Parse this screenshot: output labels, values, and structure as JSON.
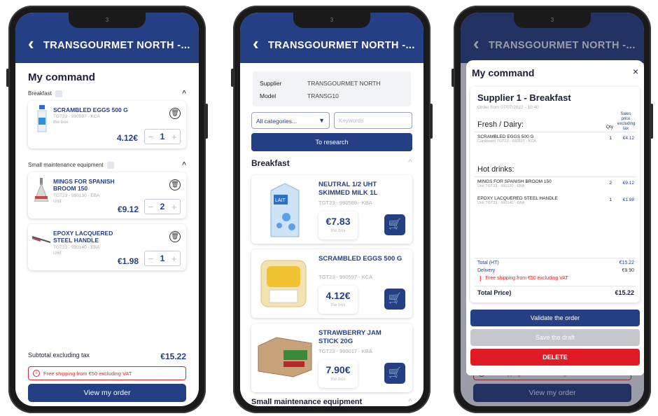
{
  "phone1": {
    "time": "3",
    "header_title": "TRANSGOURMET NORTH -...",
    "heading": "My command",
    "section1": "Breakfast",
    "section2": "Small maintenance equipment",
    "items": [
      {
        "name": "SCRAMBLED EGGS 500 G",
        "ref": "TGT23 - 990597 - KCA",
        "unit": "the box",
        "price": "4.12€",
        "qty": "1"
      },
      {
        "name": "MINGS FOR SPANISH BROOM 150",
        "ref": "TGT23 - 990130 - EBA",
        "unit": "Unit",
        "price": "€9.12",
        "qty": "2"
      },
      {
        "name": "EPOXY LACQUERED STEEL HANDLE",
        "ref": "TGT23 - 990140 - EBA",
        "unit": "Unit",
        "price": "€1.98",
        "qty": "1"
      }
    ],
    "subtotal_label": "Subtotal excluding tax",
    "subtotal_value": "€15.22",
    "warning": "Free shipping from €50 excluding VAT",
    "view_button": "View my order"
  },
  "phone2": {
    "time": "3",
    "header_title": "TRANSGOURMET NORTH -...",
    "supplier_label": "Supplier",
    "supplier_value": "TRANSGOURMET NORTH",
    "model_label": "Model",
    "model_value": "TRANSG10",
    "category_select": "All categories...",
    "keywords_placeholder": "Keywords",
    "research_button": "To research",
    "category1": "Breakfast",
    "category2": "Small maintenance equipment",
    "products": [
      {
        "name": "NEUTRAL 1/2 UHT SKIMMED MILK 1L",
        "ref": "TGT23 - 990589 - KBA",
        "price": "€7.83",
        "unit": "the box"
      },
      {
        "name": "SCRAMBLED EGGS 500 G",
        "ref": "TGT23 - 990597 - KCA",
        "price": "4.12€",
        "unit": "the box"
      },
      {
        "name": "STRAWBERRY JAM STICK 20G",
        "ref": "TGT23 - 990017 - KBA",
        "price": "7.90€",
        "unit": "the box"
      }
    ]
  },
  "phone3": {
    "time": "3",
    "header_title": "TRANSGOURMET NORTH -...",
    "modal_title": "My command",
    "close": "×",
    "order_title": "Supplier 1 - Breakfast",
    "order_date": "Order from 07/07/2022 - 10:40",
    "group1": "Fresh / Dairy:",
    "group2": "Hot drinks:",
    "col_qty": "Qty",
    "col_price": "Sales price excluding tax",
    "lines": [
      {
        "name": "SCRAMBLED EGGS 500 G",
        "sub": "Cardboard TGT23 - 990597 - KCA",
        "qty": "1",
        "price": "€4.12"
      },
      {
        "name": "MINGS FOR SPANISH BROOM 150",
        "sub": "Unit TGT23 - 990130 - EBA",
        "qty": "2",
        "price": "€9.12"
      },
      {
        "name": "EPOXY LACQUERED STEEL HANDLE",
        "sub": "Unit TGT23 - 990140 - EBA",
        "qty": "1",
        "price": "€1.98"
      }
    ],
    "total_ht_label": "Total (HT)",
    "total_ht_value": "€15.22",
    "delivery_label": "Delivery",
    "delivery_value": "€9.90",
    "warning": "Free shipping from €50 excluding VAT",
    "total_label": "Total Price)",
    "total_value": "€15.22",
    "validate_button": "Validate the order",
    "draft_button": "Save the draft",
    "delete_button": "DELETE",
    "under_warning": "Free shipping from €50 excluding VAT",
    "view_button": "View my order"
  },
  "colors": {
    "brand": "#243f84",
    "danger": "#e01b24",
    "muted": "#c5c7cc"
  }
}
